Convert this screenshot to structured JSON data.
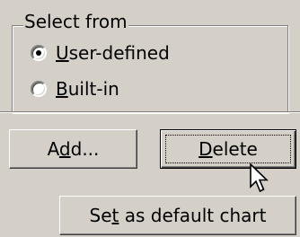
{
  "group": {
    "title": "Select from"
  },
  "radios": [
    {
      "key": "U",
      "rest": "ser-defined",
      "checked": true
    },
    {
      "key": "B",
      "rest": "uilt-in",
      "checked": false
    }
  ],
  "buttons": {
    "add": {
      "pre": "A",
      "key": "d",
      "post": "d..."
    },
    "delete": {
      "pre": "",
      "key": "D",
      "post": "elete"
    },
    "set_default": {
      "pre": "Se",
      "key": "t",
      "post": " as default chart"
    }
  },
  "cursor": {
    "icon": "arrow-pointer-icon"
  }
}
